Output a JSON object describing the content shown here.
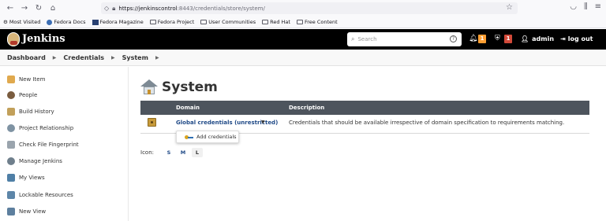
{
  "browser": {
    "url_host": "https://jenkinscontrol",
    "url_rest": ":8443/credentials/store/system/",
    "bookmarks": [
      "Most Visited",
      "Fedora Docs",
      "Fedora Magazine",
      "Fedora Project",
      "User Communities",
      "Red Hat",
      "Free Content"
    ]
  },
  "header": {
    "title": "Jenkins",
    "search_placeholder": "Search",
    "notifications_count": "1",
    "security_count": "1",
    "user": "admin",
    "logout": "log out"
  },
  "breadcrumb": [
    "Dashboard",
    "Credentials",
    "System"
  ],
  "sidebar": {
    "items": [
      {
        "label": "New Item",
        "icon": "new-item-icon",
        "color": "#e0a94e"
      },
      {
        "label": "People",
        "icon": "people-icon",
        "color": "#7a5c3f"
      },
      {
        "label": "Build History",
        "icon": "build-history-icon",
        "color": "#c2a05a"
      },
      {
        "label": "Project Relationship",
        "icon": "magnifier-icon",
        "color": "#7f93a3"
      },
      {
        "label": "Check File Fingerprint",
        "icon": "fingerprint-icon",
        "color": "#9aa4ad"
      },
      {
        "label": "Manage Jenkins",
        "icon": "gear-icon",
        "color": "#6f7f8c"
      },
      {
        "label": "My Views",
        "icon": "my-views-icon",
        "color": "#4f7fa6"
      },
      {
        "label": "Lockable Resources",
        "icon": "lock-resource-icon",
        "color": "#5d86a8"
      },
      {
        "label": "New View",
        "icon": "folder-icon",
        "color": "#5d7f9e"
      }
    ]
  },
  "main": {
    "title": "System",
    "columns": [
      "Domain",
      "Description"
    ],
    "rows": [
      {
        "domain": "Global credentials (unrestricted)",
        "description": "Credentials that should be available irrespective of domain specification to requirements matching."
      }
    ],
    "dropdown_item": "Add credentials",
    "icon_label": "Icon:",
    "icon_sizes": [
      "S",
      "M",
      "L"
    ]
  }
}
